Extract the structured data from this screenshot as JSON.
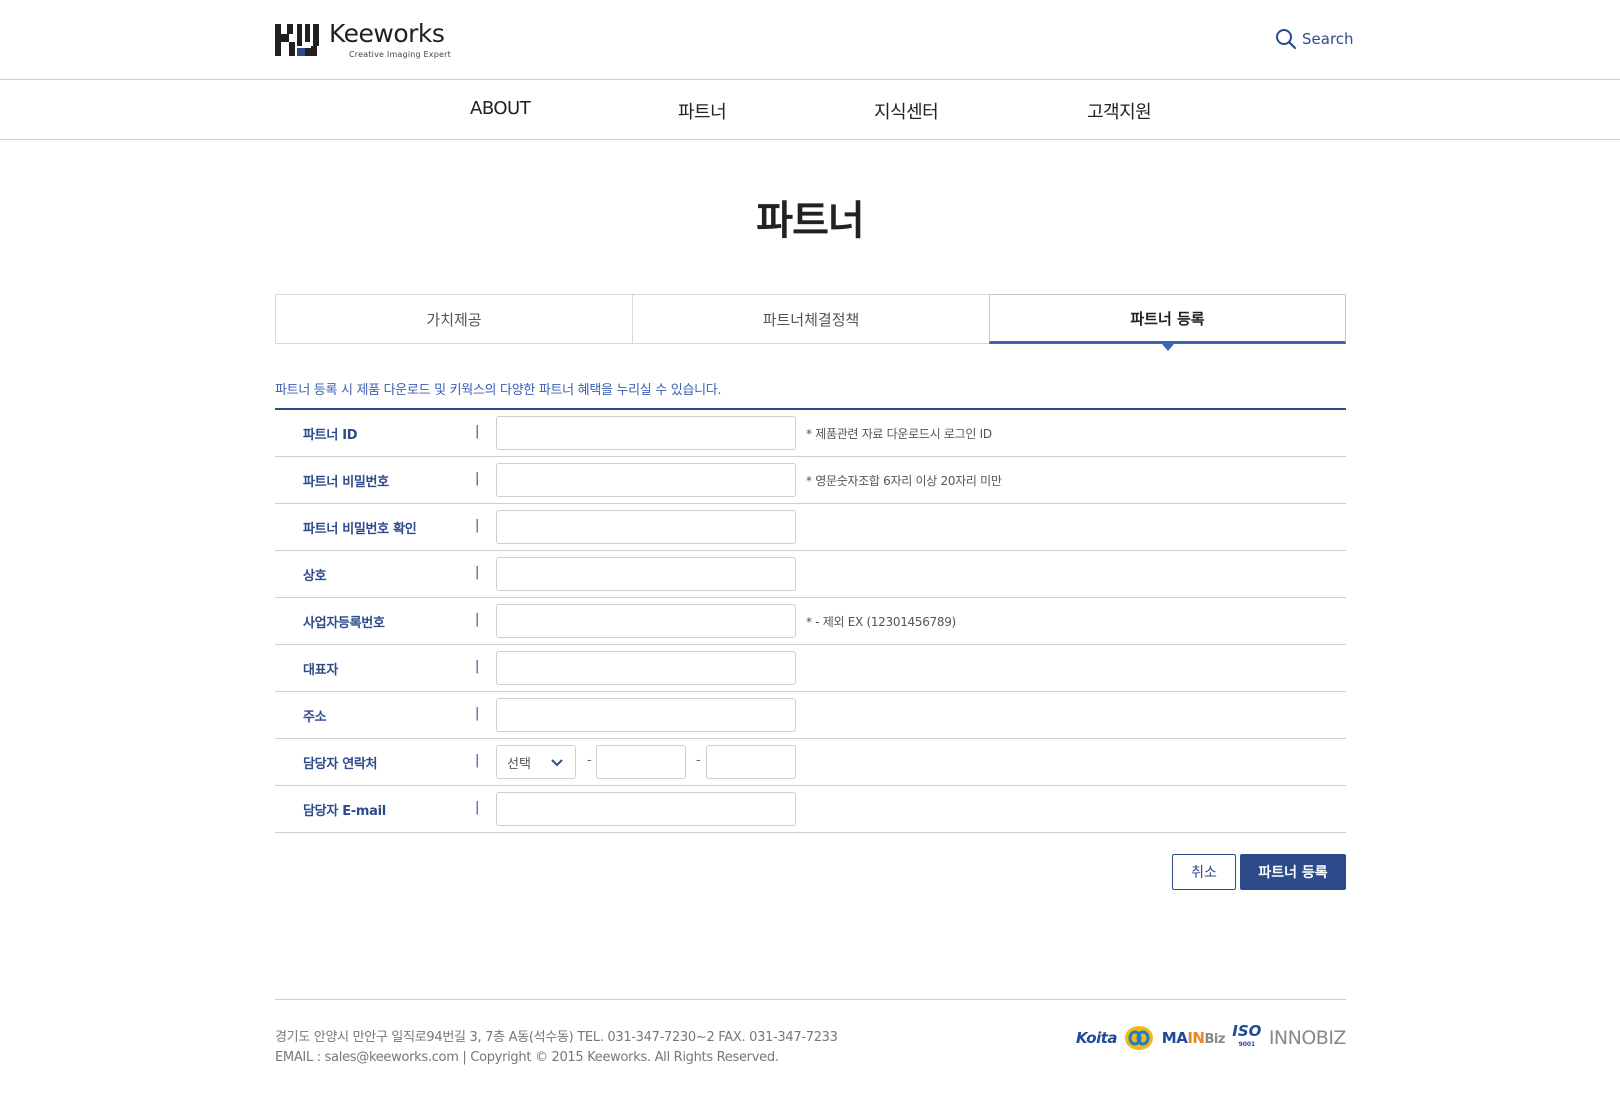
{
  "header": {
    "logo_name": "Keeworks",
    "logo_tagline": "Creative  Imaging  Expert",
    "search_label": "Search"
  },
  "nav": {
    "items": [
      {
        "label": "ABOUT"
      },
      {
        "label": "파트너"
      },
      {
        "label": "지식센터"
      },
      {
        "label": "고객지원"
      }
    ]
  },
  "page": {
    "title": "파트너",
    "intro": "파트너 등록 시 제품 다운로드 및 키웍스의 다양한 파트너 혜택을 누리실 수 있습니다."
  },
  "tabs": [
    {
      "label": "가치제공",
      "active": false
    },
    {
      "label": "파트너체결정책",
      "active": false
    },
    {
      "label": "파트너 등록",
      "active": true
    }
  ],
  "form": {
    "separator": "|",
    "rows": [
      {
        "label": "파트너 ID",
        "value": "",
        "note": "* 제품관련 자료 다운로드시 로그인 ID"
      },
      {
        "label": "파트너 비밀번호",
        "value": "",
        "note": "* 영문숫자조합 6자리 이상 20자리 미만"
      },
      {
        "label": "파트너 비밀번호 확인",
        "value": "",
        "note": ""
      },
      {
        "label": "상호",
        "value": "",
        "note": ""
      },
      {
        "label": "사업자등록번호",
        "value": "",
        "note": "* - 제외 EX (12301456789)"
      },
      {
        "label": "대표자",
        "value": "",
        "note": ""
      },
      {
        "label": "주소",
        "value": "",
        "note": ""
      },
      {
        "label": "담당자 연락처",
        "select_value": "선택",
        "dash": "-"
      },
      {
        "label": "담당자 E-mail",
        "value": "",
        "note": ""
      }
    ]
  },
  "buttons": {
    "cancel": "취소",
    "submit": "파트너 등록"
  },
  "footer": {
    "address_line": "경기도 안양시 만안구 일직로94번길 3, 7층 A동(석수동)    TEL. 031-347-7230~2  FAX. 031-347-7233",
    "copyright_line": "EMAIL : sales@keeworks.com | Copyright © 2015 Keeworks. All Rights Reserved.",
    "cert_logos": {
      "koita": "Koita",
      "mainbiz_main": "MA",
      "mainbiz_in": "IN",
      "mainbiz_biz": "Biz",
      "iso": "ISO",
      "iso_num": "9001",
      "innobiz": "INNOBIZ"
    }
  },
  "colors": {
    "brand_navy": "#2d4a8a",
    "tab_active": "#3a64b8",
    "link_blue": "#3a5fb5"
  }
}
